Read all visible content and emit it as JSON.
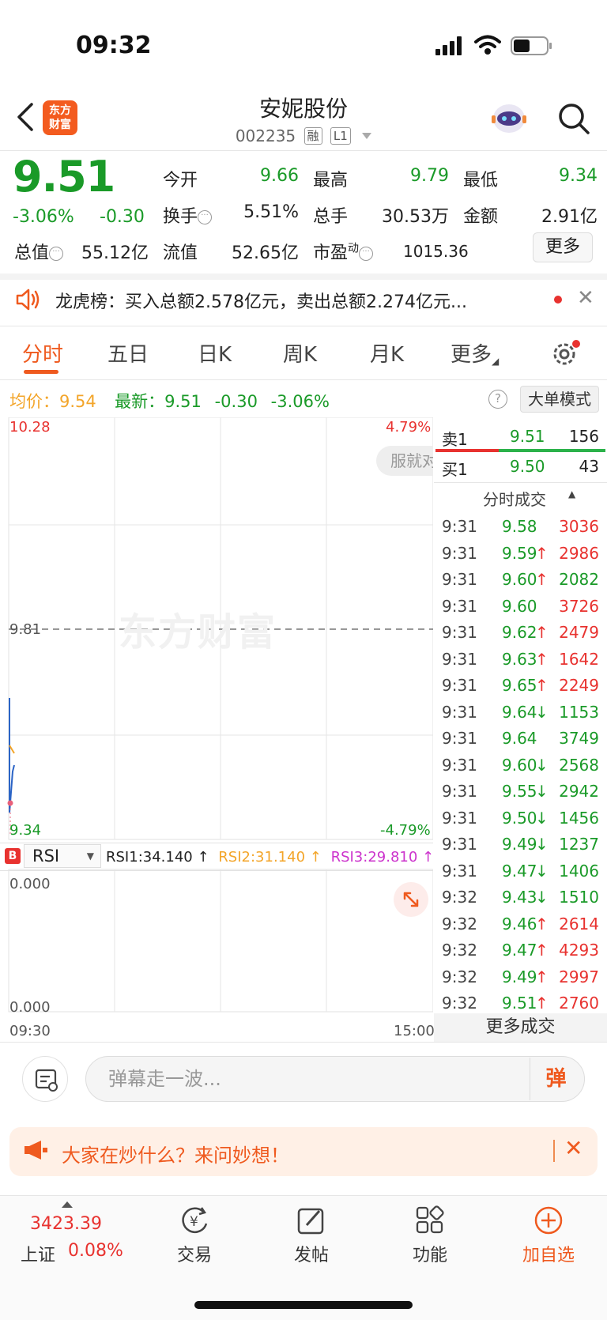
{
  "status_bar": {
    "time": "09:32"
  },
  "header": {
    "logo_line1": "东方",
    "logo_line2": "财富",
    "stock_name": "安妮股份",
    "stock_code": "002235",
    "tag_margin": "融",
    "tag_level": "L1",
    "icons": [
      "back-icon",
      "robot-icon",
      "search-icon"
    ]
  },
  "quote": {
    "price": "9.51",
    "change_pct": "-3.06%",
    "change": "-0.30",
    "open_label": "今开",
    "open": "9.66",
    "high_label": "最高",
    "high": "9.79",
    "low_label": "最低",
    "low": "9.34",
    "turnover_label": "换手",
    "turnover": "5.51%",
    "volume_label": "总手",
    "volume": "30.53万",
    "amount_label": "金额",
    "amount": "2.91亿",
    "mktcap_label": "总值",
    "mktcap": "55.12亿",
    "float_label": "流值",
    "float": "52.65亿",
    "pe_label": "市盈",
    "pe_sup": "动",
    "pe": "1015.36",
    "more_label": "更多"
  },
  "notice": {
    "text": "龙虎榜：买入总额2.578亿元，卖出总额2.274亿元..."
  },
  "tabs": [
    {
      "label": "分时",
      "active": true
    },
    {
      "label": "五日"
    },
    {
      "label": "日K"
    },
    {
      "label": "周K"
    },
    {
      "label": "月K"
    },
    {
      "label": "更多"
    }
  ],
  "info_row": {
    "avg_label": "均价：",
    "avg": "9.54",
    "latest_label": "最新：",
    "latest": "9.51",
    "latest_change": "-0.30",
    "latest_pct": "-3.06%",
    "help": "?",
    "bigorder_label": "大单模式"
  },
  "chart": {
    "y_max": "10.28",
    "y_min": "9.34",
    "y_mid": "9.81",
    "pct_max": "4.79%",
    "pct_min": "-4.79%",
    "x_start": "09:30",
    "x_end": "15:00",
    "watermark": "东方财富",
    "speech_text": "服就对"
  },
  "rsi": {
    "badge": "B",
    "selected": "RSI",
    "rsi1": "RSI1:34.140 ↑",
    "rsi2": "RSI2:31.140 ↑",
    "rsi3": "RSI3:29.810 ↑",
    "top_val": "0.000",
    "bottom_val": "0.000",
    "colors": {
      "rsi1": "#222222",
      "rsi2": "#f3a52a",
      "rsi3": "#cc33cc"
    }
  },
  "order_book": {
    "sell1_label": "卖1",
    "sell1_price": "9.51",
    "sell1_vol": "156",
    "buy1_label": "买1",
    "buy1_price": "9.50",
    "buy1_vol": "43",
    "trades_title": "分时成交",
    "more_trades": "更多成交"
  },
  "trades": [
    {
      "time": "9:31",
      "price": "9.58",
      "arrow": "",
      "vol": "3036",
      "pc": "green",
      "vc": "red"
    },
    {
      "time": "9:31",
      "price": "9.59",
      "arrow": "↑",
      "vol": "2986",
      "pc": "green",
      "vc": "red"
    },
    {
      "time": "9:31",
      "price": "9.60",
      "arrow": "↑",
      "vol": "2082",
      "pc": "green",
      "vc": "green"
    },
    {
      "time": "9:31",
      "price": "9.60",
      "arrow": "",
      "vol": "3726",
      "pc": "green",
      "vc": "red"
    },
    {
      "time": "9:31",
      "price": "9.62",
      "arrow": "↑",
      "vol": "2479",
      "pc": "green",
      "vc": "red"
    },
    {
      "time": "9:31",
      "price": "9.63",
      "arrow": "↑",
      "vol": "1642",
      "pc": "green",
      "vc": "red"
    },
    {
      "time": "9:31",
      "price": "9.65",
      "arrow": "↑",
      "vol": "2249",
      "pc": "green",
      "vc": "red"
    },
    {
      "time": "9:31",
      "price": "9.64",
      "arrow": "↓",
      "vol": "1153",
      "pc": "green",
      "vc": "green"
    },
    {
      "time": "9:31",
      "price": "9.64",
      "arrow": "",
      "vol": "3749",
      "pc": "green",
      "vc": "green"
    },
    {
      "time": "9:31",
      "price": "9.60",
      "arrow": "↓",
      "vol": "2568",
      "pc": "green",
      "vc": "green"
    },
    {
      "time": "9:31",
      "price": "9.55",
      "arrow": "↓",
      "vol": "2942",
      "pc": "green",
      "vc": "green"
    },
    {
      "time": "9:31",
      "price": "9.50",
      "arrow": "↓",
      "vol": "1456",
      "pc": "green",
      "vc": "green"
    },
    {
      "time": "9:31",
      "price": "9.49",
      "arrow": "↓",
      "vol": "1237",
      "pc": "green",
      "vc": "green"
    },
    {
      "time": "9:31",
      "price": "9.47",
      "arrow": "↓",
      "vol": "1406",
      "pc": "green",
      "vc": "green"
    },
    {
      "time": "9:32",
      "price": "9.43",
      "arrow": "↓",
      "vol": "1510",
      "pc": "green",
      "vc": "green"
    },
    {
      "time": "9:32",
      "price": "9.46",
      "arrow": "↑",
      "vol": "2614",
      "pc": "green",
      "vc": "red"
    },
    {
      "time": "9:32",
      "price": "9.47",
      "arrow": "↑",
      "vol": "4293",
      "pc": "green",
      "vc": "red"
    },
    {
      "time": "9:32",
      "price": "9.49",
      "arrow": "↑",
      "vol": "2997",
      "pc": "green",
      "vc": "red"
    },
    {
      "time": "9:32",
      "price": "9.51",
      "arrow": "↑",
      "vol": "2760",
      "pc": "green",
      "vc": "red"
    }
  ],
  "comment": {
    "placeholder": "弹幕走一波...",
    "danmu_label": "弹"
  },
  "ad": {
    "text": "大家在炒什么？来问妙想！"
  },
  "bottom_nav": {
    "index_value": "3423.39",
    "index_name": "上证",
    "index_pct": "0.08%",
    "trade_label": "交易",
    "post_label": "发帖",
    "func_label": "功能",
    "add_label": "加自选"
  }
}
